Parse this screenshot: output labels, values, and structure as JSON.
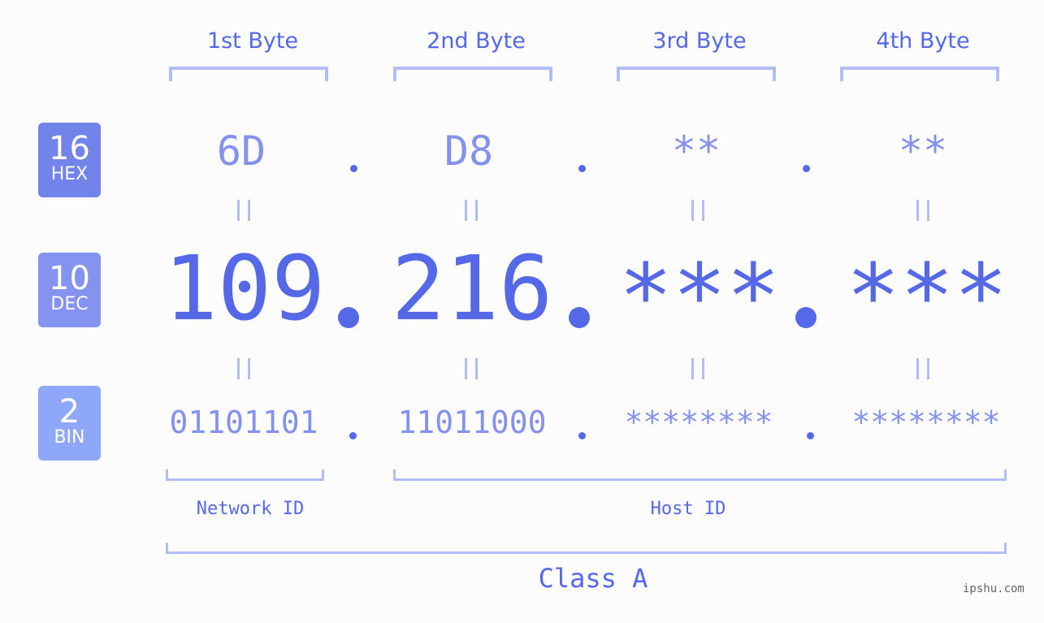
{
  "bytes": [
    {
      "header": "1st Byte",
      "hex": "6D",
      "dec": "109",
      "bin": "01101101"
    },
    {
      "header": "2nd Byte",
      "hex": "D8",
      "dec": "216",
      "bin": "11011000"
    },
    {
      "header": "3rd Byte",
      "hex": "**",
      "dec": "***",
      "bin": "********"
    },
    {
      "header": "4th Byte",
      "hex": "**",
      "dec": "***",
      "bin": "********"
    }
  ],
  "badges": {
    "hex": {
      "num": "16",
      "label": "HEX",
      "color": "#7283ea"
    },
    "dec": {
      "num": "10",
      "label": "DEC",
      "color": "#8493f0"
    },
    "bin": {
      "num": "2",
      "label": "BIN",
      "color": "#8fa7f8"
    }
  },
  "separator": ".",
  "equals": "=",
  "labels": {
    "network_id": "Network ID",
    "host_id": "Host ID",
    "ip_class": "Class A"
  },
  "watermark": "ipshu.com",
  "colors": {
    "primary": "#5468e8",
    "secondary": "#8491ee",
    "bracket": "#b2bdf6",
    "background": "#fbfcfb"
  }
}
